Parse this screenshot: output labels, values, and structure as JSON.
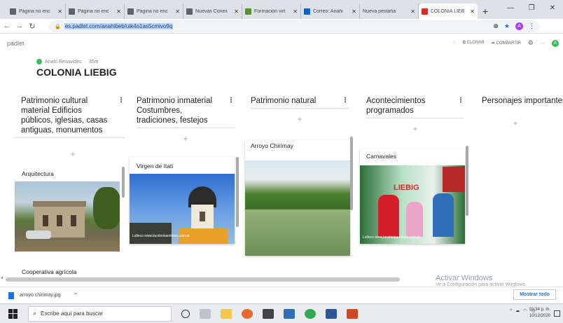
{
  "browser": {
    "tabs": [
      {
        "label": "Página no enc",
        "active": false
      },
      {
        "label": "Página no enc",
        "active": false
      },
      {
        "label": "Página no enc",
        "active": false
      },
      {
        "label": "Nuevas Conex",
        "active": false
      },
      {
        "label": "Formación virt",
        "active": false
      },
      {
        "label": "Correo: Anahi",
        "active": false
      },
      {
        "label": "Nueva pestaña",
        "active": false
      },
      {
        "label": "COLONIA LIEB",
        "active": true
      }
    ],
    "url": "es.padlet.com/anahibeb/uik4o1as5cmivo9q"
  },
  "padlet": {
    "logo": "padlet",
    "clone_label": "CLONAR",
    "share_label": "COMPARTIR",
    "author": "Anahi Benavides",
    "time_ago": "35m",
    "title": "COLONIA LIEBIG"
  },
  "columns": [
    {
      "title": "Patrimonio cultural material Edificios públicos, iglesias, casas antiguas, monumentos",
      "add": "+"
    },
    {
      "title": "Patrimonio inmaterial Costumbres, tradiciones, festejos",
      "add": "+"
    },
    {
      "title": "Patrimonio natural",
      "add": "+"
    },
    {
      "title": "Acontecimientos programados",
      "add": "+"
    },
    {
      "title": "Personajes importantes",
      "add": "+"
    }
  ],
  "cards": [
    {
      "title": "Arquitectura"
    },
    {
      "title": "Virgen de Itati",
      "img_caption": "Lolleco www.lacoloniaenlinea.com.ar"
    },
    {
      "title": "Arroyo Chirimay"
    },
    {
      "title": "Carnavales",
      "img_caption": "Lolleco www.lacoloniaenlinea.com.ar"
    },
    {
      "title": "Cooperativa agrícola"
    }
  ],
  "watermark": {
    "line1": "Activar Windows",
    "line2": "Ve a Configuración para activar Windows."
  },
  "download": {
    "filename": "arroyo chirimay.jpg",
    "show_all": "Mostrar todo"
  },
  "taskbar": {
    "search_placeholder": "Escribe aquí para buscar",
    "time": "01:34 p. m.",
    "date": "10/12/2020"
  }
}
